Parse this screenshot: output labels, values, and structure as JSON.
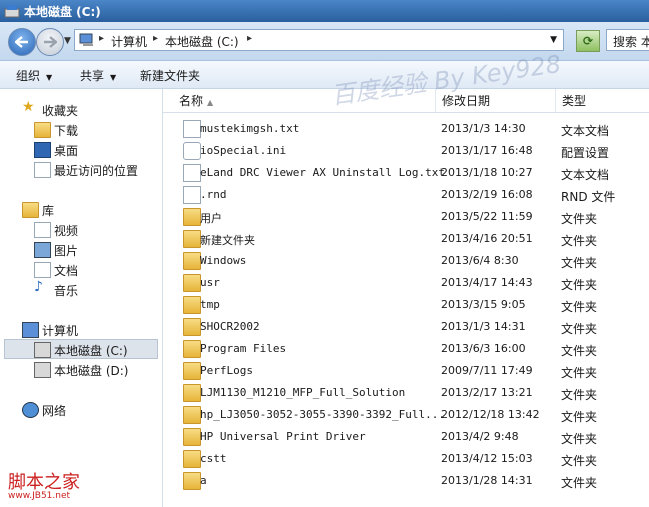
{
  "window": {
    "title": "本地磁盘 (C:)"
  },
  "address": {
    "crumbs": [
      "计算机",
      "本地磁盘 (C:)"
    ],
    "separator": "▸",
    "search_placeholder": "搜索 本"
  },
  "toolbar": {
    "organize_label": "组织",
    "share_label": "共享",
    "new_folder_label": "新建文件夹"
  },
  "sidebar": {
    "favorites": {
      "label": "收藏夹",
      "items": [
        "下载",
        "桌面",
        "最近访问的位置"
      ]
    },
    "libraries": {
      "label": "库",
      "items": [
        "视频",
        "图片",
        "文档",
        "音乐"
      ]
    },
    "computer": {
      "label": "计算机",
      "items": [
        "本地磁盘 (C:)",
        "本地磁盘 (D:)"
      ]
    },
    "network": {
      "label": "网络"
    }
  },
  "columns": {
    "name": "名称",
    "date": "修改日期",
    "type": "类型"
  },
  "files": [
    {
      "name": "mustekimgsh.txt",
      "date": "2013/1/3 14:30",
      "type": "文本文档",
      "icon": "text-file-icon"
    },
    {
      "name": "ioSpecial.ini",
      "date": "2013/1/17 16:48",
      "type": "配置设置",
      "icon": "ini-file-icon"
    },
    {
      "name": "eLand DRC Viewer AX Uninstall Log.txt",
      "date": "2013/1/18 10:27",
      "type": "文本文档",
      "icon": "text-file-icon"
    },
    {
      "name": ".rnd",
      "date": "2013/2/19 16:08",
      "type": "RND 文件",
      "icon": "file-icon"
    },
    {
      "name": "用户",
      "date": "2013/5/22 11:59",
      "type": "文件夹",
      "icon": "folder-icon"
    },
    {
      "name": "新建文件夹",
      "date": "2013/4/16 20:51",
      "type": "文件夹",
      "icon": "folder-icon"
    },
    {
      "name": "Windows",
      "date": "2013/6/4 8:30",
      "type": "文件夹",
      "icon": "folder-icon"
    },
    {
      "name": "usr",
      "date": "2013/4/17 14:43",
      "type": "文件夹",
      "icon": "folder-icon"
    },
    {
      "name": "tmp",
      "date": "2013/3/15 9:05",
      "type": "文件夹",
      "icon": "folder-icon"
    },
    {
      "name": "SHOCR2002",
      "date": "2013/1/3 14:31",
      "type": "文件夹",
      "icon": "folder-icon"
    },
    {
      "name": "Program Files",
      "date": "2013/6/3 16:00",
      "type": "文件夹",
      "icon": "folder-icon"
    },
    {
      "name": "PerfLogs",
      "date": "2009/7/11 17:49",
      "type": "文件夹",
      "icon": "folder-icon"
    },
    {
      "name": "LJM1130_M1210_MFP_Full_Solution",
      "date": "2013/2/17 13:21",
      "type": "文件夹",
      "icon": "folder-icon"
    },
    {
      "name": "hp_LJ3050-3052-3055-3390-3392_Full...",
      "date": "2012/12/18 13:42",
      "type": "文件夹",
      "icon": "folder-icon"
    },
    {
      "name": "HP Universal Print Driver",
      "date": "2013/4/2 9:48",
      "type": "文件夹",
      "icon": "folder-icon"
    },
    {
      "name": "cstt",
      "date": "2013/4/12 15:03",
      "type": "文件夹",
      "icon": "folder-icon"
    },
    {
      "name": "a",
      "date": "2013/1/28 14:31",
      "type": "文件夹",
      "icon": "folder-icon"
    }
  ],
  "watermark": "百度经验 By Key928",
  "site_mark": {
    "name": "脚本之家",
    "url": "www.JB51.net"
  }
}
